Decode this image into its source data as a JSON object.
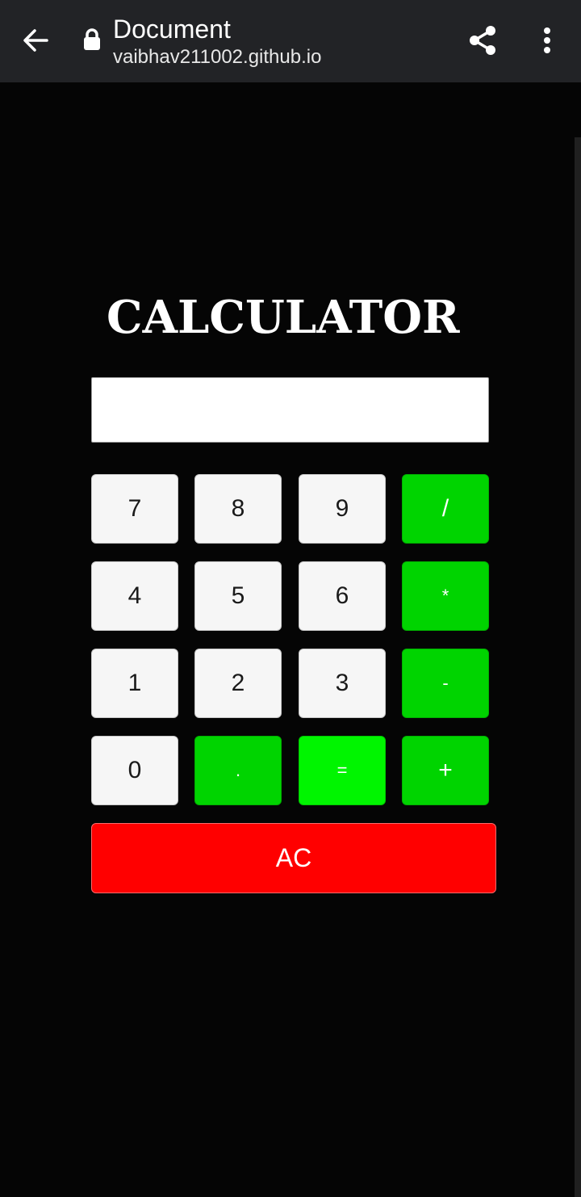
{
  "browser": {
    "title": "Document",
    "url": "vaibhav211002.github.io"
  },
  "calculator": {
    "heading": "CALCULATOR",
    "display_value": "",
    "keys": [
      {
        "label": "7",
        "kind": "num"
      },
      {
        "label": "8",
        "kind": "num"
      },
      {
        "label": "9",
        "kind": "num"
      },
      {
        "label": "/",
        "kind": "op"
      },
      {
        "label": "4",
        "kind": "num"
      },
      {
        "label": "5",
        "kind": "num"
      },
      {
        "label": "6",
        "kind": "num"
      },
      {
        "label": "*",
        "kind": "op"
      },
      {
        "label": "1",
        "kind": "num"
      },
      {
        "label": "2",
        "kind": "num"
      },
      {
        "label": "3",
        "kind": "num"
      },
      {
        "label": "-",
        "kind": "op"
      },
      {
        "label": "0",
        "kind": "num"
      },
      {
        "label": ".",
        "kind": "op"
      },
      {
        "label": "=",
        "kind": "eq"
      },
      {
        "label": "+",
        "kind": "op"
      }
    ],
    "clear_label": "AC"
  },
  "colors": {
    "background": "#050505",
    "toolbar": "#222326",
    "number_key": "#f6f6f6",
    "operator_key": "#00d400",
    "equals_key": "#00f500",
    "clear_key": "#ff0000"
  },
  "icons": {
    "back": "arrow-left-icon",
    "lock": "lock-icon",
    "share": "share-icon",
    "menu": "more-vertical-icon"
  }
}
